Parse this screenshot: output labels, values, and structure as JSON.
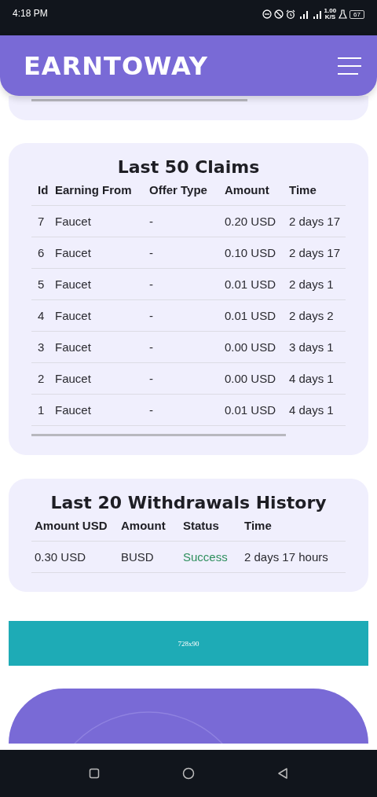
{
  "status_bar": {
    "time": "4:18 PM",
    "net_speed": [
      "1.00",
      "K/S"
    ],
    "battery": "67"
  },
  "header": {
    "brand": "EARNTOWAY"
  },
  "claims": {
    "title": "Last 50 Claims",
    "columns": [
      "Id",
      "Earning From",
      "Offer Type",
      "Amount",
      "Time"
    ],
    "rows": [
      [
        "7",
        "Faucet",
        "-",
        "0.20 USD",
        "2 days 17"
      ],
      [
        "6",
        "Faucet",
        "-",
        "0.10 USD",
        "2 days 17"
      ],
      [
        "5",
        "Faucet",
        "-",
        "0.01 USD",
        "2 days 1"
      ],
      [
        "4",
        "Faucet",
        "-",
        "0.01 USD",
        "2 days 2"
      ],
      [
        "3",
        "Faucet",
        "-",
        "0.00 USD",
        "3 days 1"
      ],
      [
        "2",
        "Faucet",
        "-",
        "0.00 USD",
        "4 days 1"
      ],
      [
        "1",
        "Faucet",
        "-",
        "0.01 USD",
        "4 days 1"
      ]
    ]
  },
  "withdrawals": {
    "title": "Last 20 Withdrawals History",
    "columns": [
      "Amount USD",
      "Amount",
      "Status",
      "Time"
    ],
    "rows": [
      {
        "amount_usd": "0.30 USD",
        "amount": "BUSD",
        "status": "Success",
        "success": true,
        "time": "2 days 17 hours"
      }
    ]
  },
  "ad": {
    "label": "728x90"
  }
}
